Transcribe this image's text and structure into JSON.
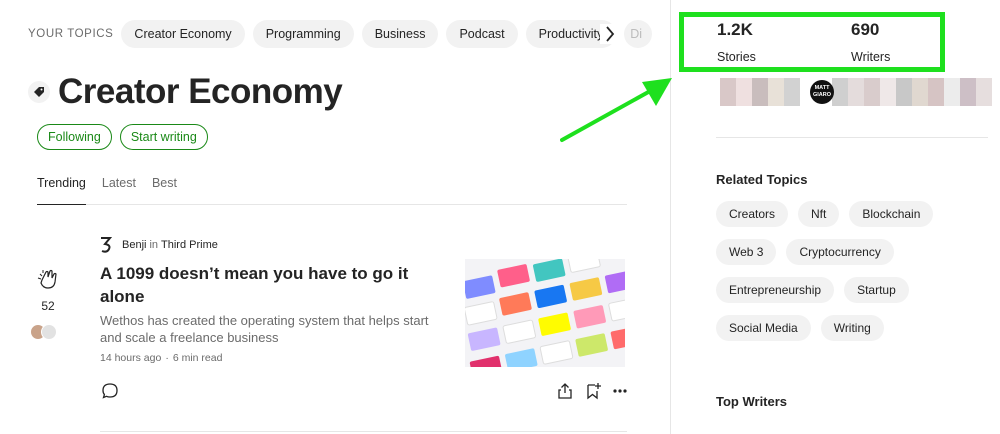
{
  "topics": {
    "label": "YOUR TOPICS",
    "items": [
      "Creator Economy",
      "Programming",
      "Business",
      "Podcast",
      "Productivity",
      "Di"
    ]
  },
  "topic_page": {
    "title": "Creator Economy",
    "following_label": "Following",
    "start_writing_label": "Start writing"
  },
  "tabs": [
    "Trending",
    "Latest",
    "Best"
  ],
  "post": {
    "author": "Benji",
    "in_word": "in",
    "publication": "Third Prime",
    "title": "A 1099 doesn’t mean you have to go it alone",
    "subtitle": "Wethos has created the operating system that helps start and scale a freelance business",
    "time_ago": "14 hours ago",
    "separator": "·",
    "read_time": "6 min read",
    "claps": "52"
  },
  "stats": {
    "stories_count": "1.2K",
    "stories_label": "Stories",
    "writers_count": "690",
    "writers_label": "Writers"
  },
  "writer_avatar_text": "MATT GIARO",
  "related_topics": {
    "heading": "Related Topics",
    "rows": [
      [
        "Creators",
        "Nft",
        "Blockchain"
      ],
      [
        "Web 3",
        "Cryptocurrency"
      ],
      [
        "Entrepreneurship",
        "Startup"
      ],
      [
        "Social Media",
        "Writing"
      ]
    ]
  },
  "top_writers_heading": "Top Writers",
  "colors": {
    "accent_green": "#1a8917",
    "highlight_green": "#1ee01e",
    "text_primary": "#242424",
    "text_secondary": "#6b6b6b"
  }
}
